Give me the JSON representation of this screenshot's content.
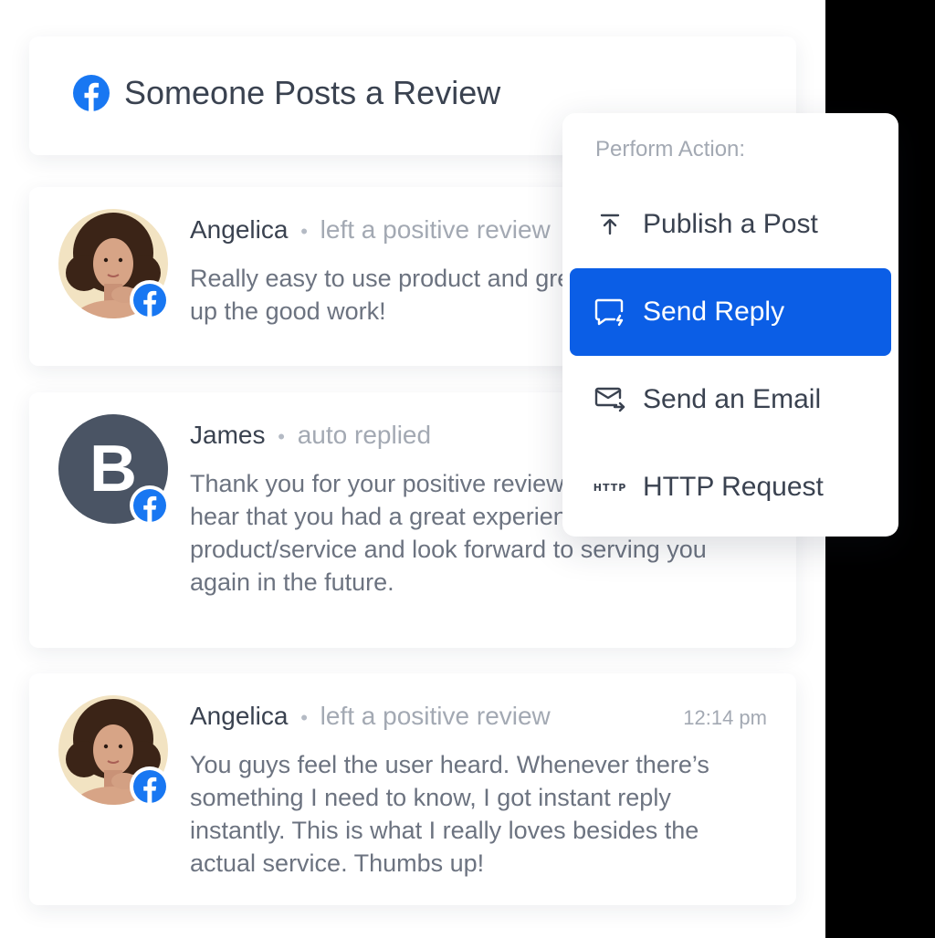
{
  "colors": {
    "facebook": "#1877F2",
    "accent": "#0B5EE6",
    "text_dark": "#3A4250",
    "text_muted": "#A3A9B3",
    "text_body": "#6C7380",
    "avatar_letter_bg": "#4A5464"
  },
  "header": {
    "icon": "facebook-icon",
    "title": "Someone Posts a Review"
  },
  "reviews": [
    {
      "name": "Angelica",
      "separator": "•",
      "action": "left a positive review",
      "time": "",
      "text": "Really easy to use product and great support. Keep up the good work!",
      "avatar": "photo-avatar",
      "badge_icon": "facebook-icon"
    },
    {
      "name": "James",
      "separator": "•",
      "action": "auto replied",
      "time": "",
      "avatar_letter": "B",
      "text": "Thank you for your positive review! We're thrilled to hear that you had a great experience with our product/service and look forward to serving you again in the future.",
      "avatar": "letter-avatar",
      "badge_icon": "facebook-icon"
    },
    {
      "name": "Angelica",
      "separator": "•",
      "action": "left a positive review",
      "time": "12:14 pm",
      "text": "You guys feel the user heard. Whenever there’s something I need to know, I got instant reply instantly. This is what I really loves besides the actual service. Thumbs up!",
      "avatar": "photo-avatar",
      "badge_icon": "facebook-icon"
    }
  ],
  "action_menu": {
    "heading": "Perform Action:",
    "items": [
      {
        "label": "Publish a Post",
        "icon": "upload-icon",
        "active": false
      },
      {
        "label": "Send Reply",
        "icon": "reply-icon",
        "active": true
      },
      {
        "label": "Send an Email",
        "icon": "email-send-icon",
        "active": false
      },
      {
        "label": "HTTP Request",
        "icon": "http-icon",
        "icon_text": "HTTP",
        "active": false
      }
    ]
  }
}
